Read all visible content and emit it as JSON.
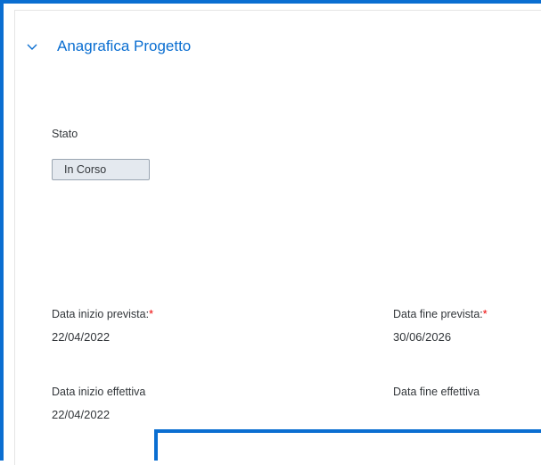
{
  "section": {
    "title": "Anagrafica Progetto",
    "chevron_icon": "chevron-down-icon"
  },
  "status": {
    "label": "Stato",
    "value": "In Corso"
  },
  "dates": {
    "start_planned_label": "Data inizio prevista:",
    "start_planned_value": "22/04/2022",
    "end_planned_label": "Data fine prevista:",
    "end_planned_value": "30/06/2026",
    "start_actual_label": "Data inizio effettiva",
    "start_actual_value": "22/04/2022",
    "end_actual_label": "Data fine effettiva",
    "required_marker": "*"
  },
  "colors": {
    "accent": "#0a6ed1",
    "text": "#32363a",
    "required": "#ee0000",
    "badge_bg": "#e4e9ef"
  }
}
